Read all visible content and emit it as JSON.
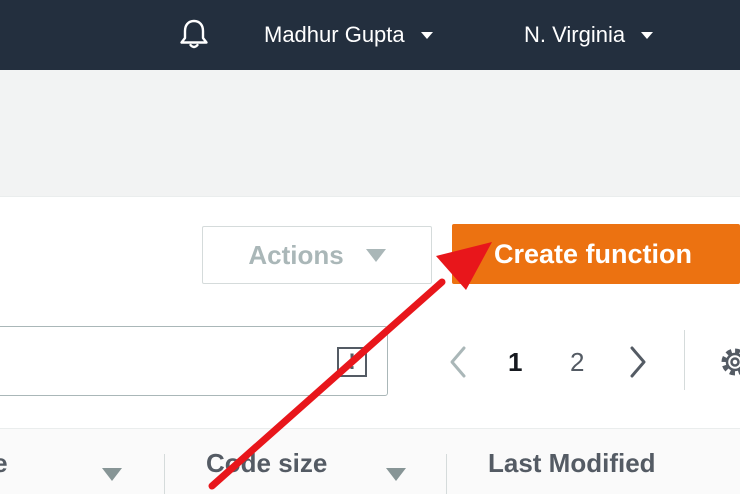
{
  "topnav": {
    "bell_icon": "bell-icon",
    "user_name": "Madhur Gupta",
    "region": "N. Virginia"
  },
  "toolbar": {
    "actions_label": "Actions",
    "create_label": "Create function"
  },
  "search": {
    "value": "",
    "clear_icon": "!"
  },
  "pagination": {
    "current_page": "1",
    "next_page": "2"
  },
  "table": {
    "columns": [
      "me",
      "Code size",
      "Last Modified"
    ]
  },
  "annotation": {
    "arrow_color": "#e8161b"
  },
  "colors": {
    "nav_bg": "#232f3e",
    "primary": "#ec7211"
  }
}
